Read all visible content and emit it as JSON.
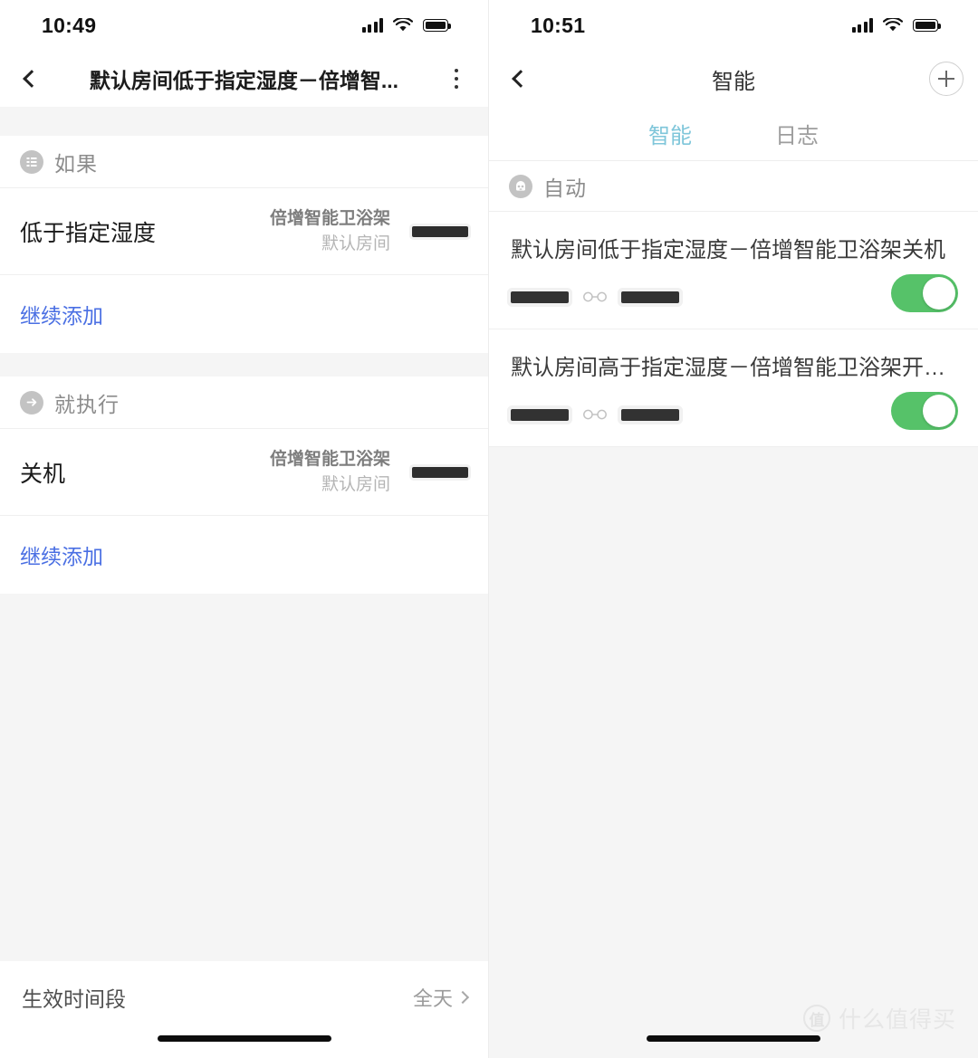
{
  "colors": {
    "accent_link": "#4a6fe3",
    "tab_active": "#7fc6da",
    "toggle_on": "#56c269",
    "page_bg": "#f5f5f5",
    "card_bg": "#ffffff"
  },
  "left_screen": {
    "status": {
      "time": "10:49",
      "signal_icon": "signal-bars-icon",
      "wifi_icon": "wifi-icon",
      "battery_icon": "battery-icon"
    },
    "nav": {
      "back_icon": "chevron-left-icon",
      "title": "默认房间低于指定湿度－倍增智...",
      "more_icon": "more-vertical-icon"
    },
    "if_section": {
      "icon": "list-icon",
      "label": "如果",
      "rows": [
        {
          "title": "低于指定湿度",
          "device": "倍增智能卫浴架",
          "room": "默认房间",
          "value_redacted": true
        }
      ],
      "add_label": "继续添加"
    },
    "then_section": {
      "icon": "arrow-right-icon",
      "label": "就执行",
      "rows": [
        {
          "title": "关机",
          "device": "倍增智能卫浴架",
          "room": "默认房间",
          "value_redacted": true
        }
      ],
      "add_label": "继续添加"
    },
    "bottom": {
      "label": "生效时间段",
      "value": "全天",
      "chevron_icon": "chevron-right-icon"
    }
  },
  "right_screen": {
    "status": {
      "time": "10:51",
      "signal_icon": "signal-bars-icon",
      "wifi_icon": "wifi-icon",
      "battery_icon": "battery-icon"
    },
    "nav": {
      "back_icon": "chevron-left-icon",
      "title": "智能",
      "add_icon": "plus-circle-icon"
    },
    "tabs": [
      {
        "label": "智能",
        "active": true
      },
      {
        "label": "日志",
        "active": false
      }
    ],
    "auto_section": {
      "icon": "robot-icon",
      "label": "自动",
      "items": [
        {
          "name": "默认房间低于指定湿度－倍增智能卫浴架关机",
          "link_icon": "link-icon",
          "toggle_on": true
        },
        {
          "name": "默认房间高于指定湿度－倍增智能卫浴架开启-...",
          "link_icon": "link-icon",
          "toggle_on": true
        }
      ]
    }
  },
  "watermark": {
    "logo_text": "值",
    "text": "什么值得买"
  }
}
